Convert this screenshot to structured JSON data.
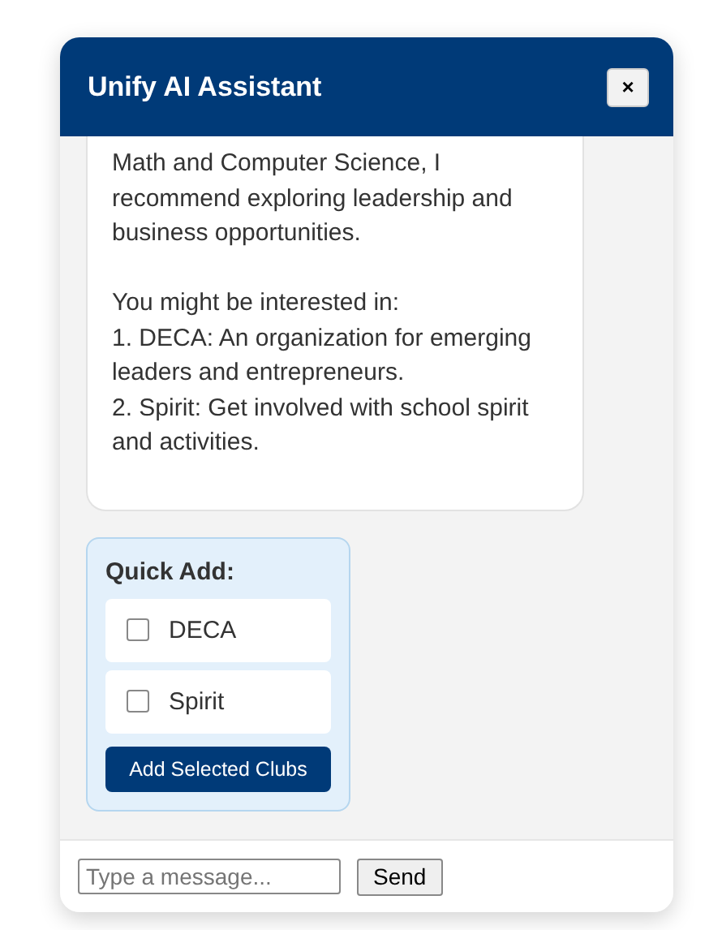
{
  "window": {
    "title": "Unify AI Assistant",
    "close_label": "×"
  },
  "message": {
    "paragraphs": [
      "Math and Computer Science, I recommend exploring leadership and business opportunities."
    ],
    "intro": "You might be interested in:",
    "items": [
      "1. DECA: An organization for emerging leaders and entrepreneurs.",
      "2. Spirit: Get involved with school spirit and activities."
    ]
  },
  "quick_add": {
    "title": "Quick Add:",
    "options": [
      {
        "label": "DECA",
        "checked": false
      },
      {
        "label": "Spirit",
        "checked": false
      }
    ],
    "button": "Add Selected Clubs"
  },
  "composer": {
    "placeholder": "Type a message...",
    "send": "Send"
  }
}
